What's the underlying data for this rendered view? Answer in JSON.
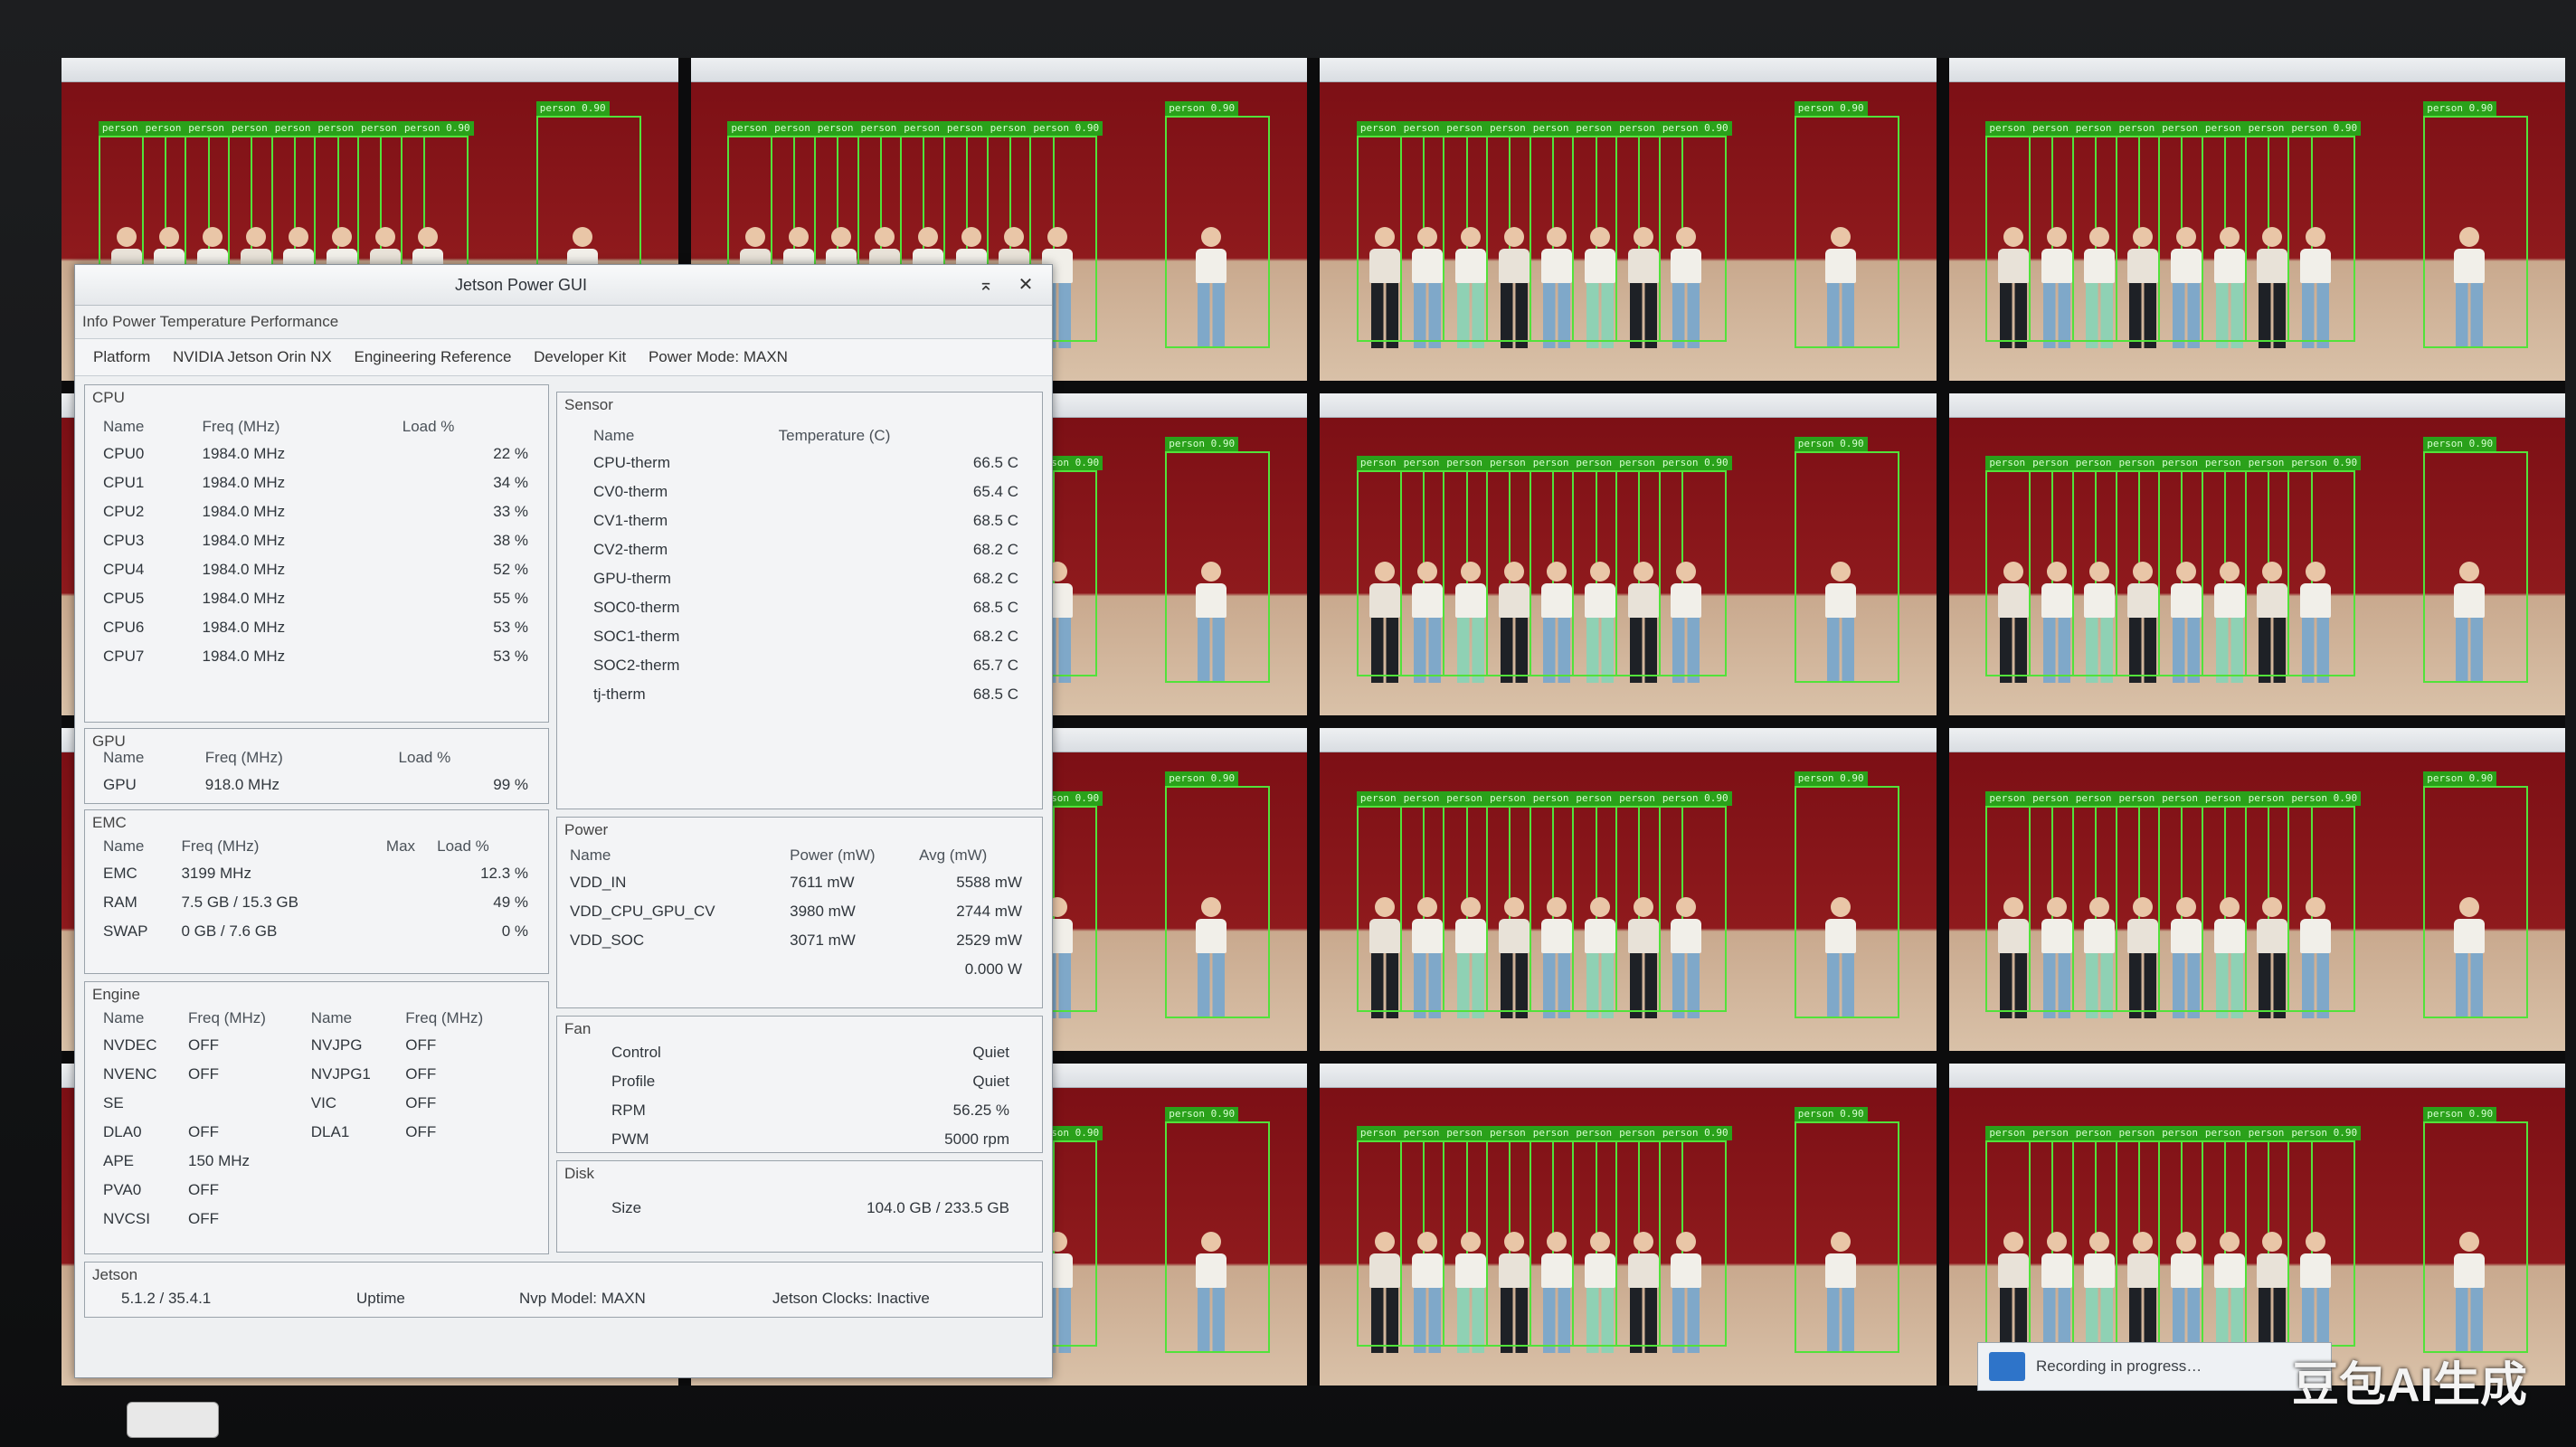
{
  "watermark": "豆包AI生成",
  "window": {
    "title": "Jetson Power GUI",
    "subtitle": "Info  Power  Temperature  Performance",
    "close_glyph": "✕",
    "restore_glyph": "⌅",
    "menu": [
      "Platform",
      "NVIDIA Jetson Orin NX",
      "Engineering Reference",
      "Developer Kit",
      "Power Mode: MAXN"
    ],
    "cpu": {
      "header": "CPU",
      "columns": [
        "Name",
        "Freq (MHz)",
        "Load %"
      ],
      "rows": [
        [
          "CPU0",
          "1984.0 MHz",
          "22 %"
        ],
        [
          "CPU1",
          "1984.0 MHz",
          "34 %"
        ],
        [
          "CPU2",
          "1984.0 MHz",
          "33 %"
        ],
        [
          "CPU3",
          "1984.0 MHz",
          "38 %"
        ],
        [
          "CPU4",
          "1984.0 MHz",
          "52 %"
        ],
        [
          "CPU5",
          "1984.0 MHz",
          "55 %"
        ],
        [
          "CPU6",
          "1984.0 MHz",
          "53 %"
        ],
        [
          "CPU7",
          "1984.0 MHz",
          "53 %"
        ]
      ]
    },
    "sensor": {
      "header": "Sensor",
      "columns": [
        "Name",
        "Temperature (C)"
      ],
      "rows": [
        [
          "CPU-therm",
          "66.5 C"
        ],
        [
          "CV0-therm",
          "65.4 C"
        ],
        [
          "CV1-therm",
          "68.5 C"
        ],
        [
          "CV2-therm",
          "68.2 C"
        ],
        [
          "GPU-therm",
          "68.2 C"
        ],
        [
          "SOC0-therm",
          "68.5 C"
        ],
        [
          "SOC1-therm",
          "68.2 C"
        ],
        [
          "SOC2-therm",
          "65.7 C"
        ],
        [
          "tj-therm",
          "68.5 C"
        ]
      ]
    },
    "gpu": {
      "header": "GPU",
      "columns": [
        "Name",
        "Freq (MHz)",
        "Load %"
      ],
      "rows": [
        [
          "GPU",
          "918.0 MHz",
          "99 %"
        ]
      ]
    },
    "emc": {
      "header": "EMC",
      "columns": [
        "Name",
        "Freq (MHz)",
        "Max",
        "Load %"
      ],
      "rows": [
        [
          "EMC",
          "3199 MHz",
          "",
          "12.3 %"
        ],
        [
          "RAM",
          "7.5 GB / 15.3 GB",
          "",
          "49 %"
        ],
        [
          "SWAP",
          "0 GB / 7.6 GB",
          "",
          "0 %"
        ]
      ]
    },
    "power": {
      "header": "Power",
      "columns": [
        "Name",
        "Power (mW)",
        "Avg (mW)"
      ],
      "rows": [
        [
          "VDD_IN",
          "7611 mW",
          "5588 mW"
        ],
        [
          "VDD_CPU_GPU_CV",
          "3980 mW",
          "2744 mW"
        ],
        [
          "VDD_SOC",
          "3071 mW",
          "2529 mW"
        ],
        [
          "",
          "",
          "0.000 W"
        ]
      ]
    },
    "engine": {
      "header": "Engine",
      "columns": [
        "Name",
        "Freq (MHz)",
        "Name",
        "Freq (MHz)"
      ],
      "rows": [
        [
          "NVDEC",
          "OFF",
          "NVJPG",
          "OFF"
        ],
        [
          "NVENC",
          "OFF",
          "NVJPG1",
          "OFF"
        ],
        [
          "SE",
          "",
          "VIC",
          "OFF"
        ],
        [
          "DLA0",
          "OFF",
          "DLA1",
          "OFF"
        ],
        [
          "APE",
          "150 MHz",
          "",
          ""
        ],
        [
          "PVA0",
          "OFF",
          "",
          ""
        ],
        [
          "NVCSI",
          "OFF",
          "",
          ""
        ]
      ]
    },
    "fan": {
      "header": "Fan",
      "rows": [
        [
          "Control",
          "Quiet"
        ],
        [
          "Profile",
          "Quiet"
        ],
        [
          "RPM",
          "56.25 %"
        ],
        [
          "PWM",
          "5000 rpm"
        ]
      ]
    },
    "disk": {
      "header": "Disk",
      "rows": [
        [
          "Size",
          "104.0 GB / 233.5 GB"
        ]
      ]
    },
    "status": {
      "header": "Jetson",
      "items": [
        "5.1.2 / 35.4.1",
        "Uptime",
        "Nvp Model: MAXN",
        "Jetson Clocks: Inactive"
      ]
    }
  },
  "detection": {
    "box_color": "#52e23a",
    "label": "person 0.90"
  },
  "notification": {
    "text": "Recording in progress…"
  }
}
